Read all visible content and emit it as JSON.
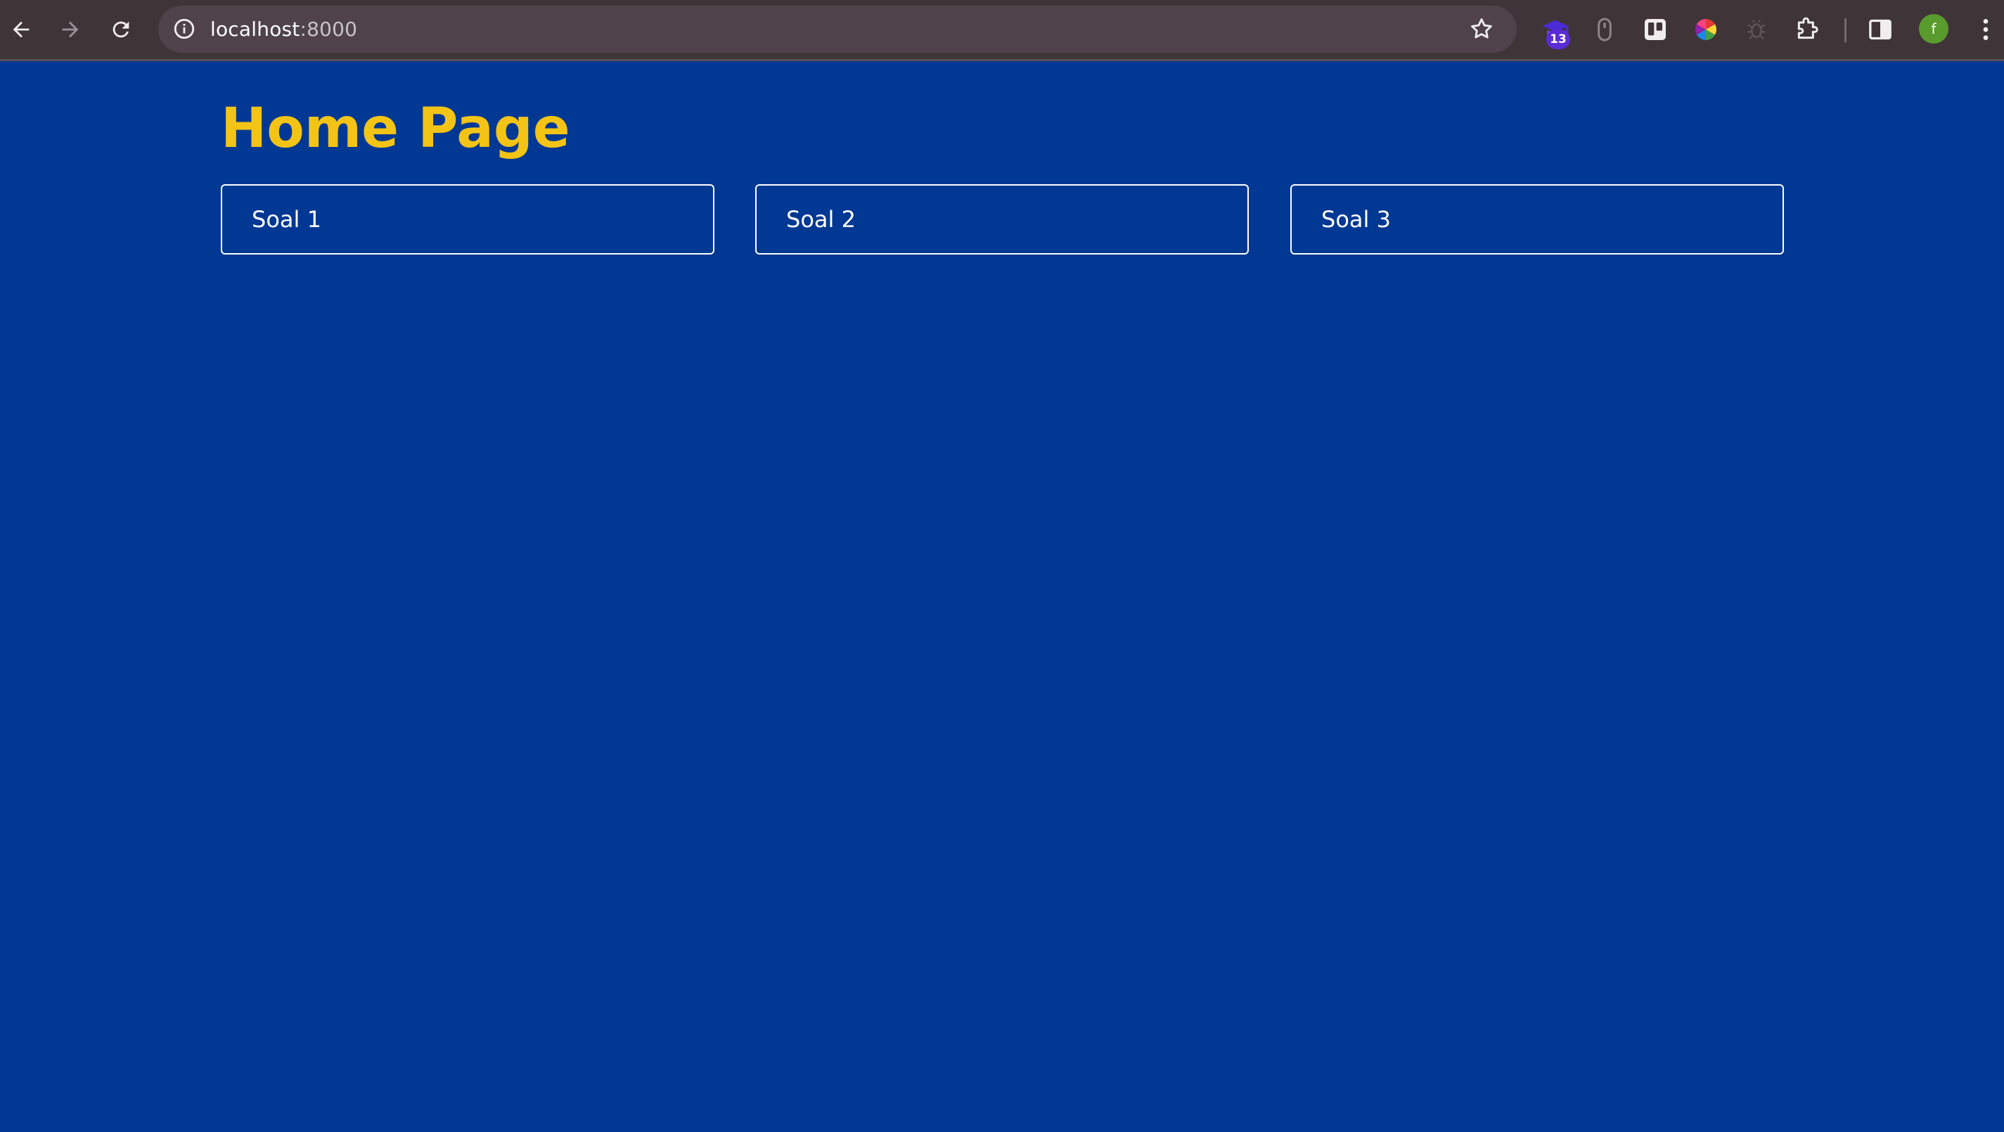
{
  "browser": {
    "address_host": "localhost",
    "address_port": ":8000",
    "extension_badge": "13",
    "profile_initial": "f",
    "icons": [
      "back-arrow-icon",
      "forward-arrow-icon",
      "reload-icon",
      "info-icon",
      "star-icon",
      "graduation-cap-icon",
      "mouse-icon",
      "trello-icon",
      "color-wheel-icon",
      "bug-icon",
      "puzzle-icon",
      "side-panel-icon",
      "kebab-menu-icon"
    ]
  },
  "page": {
    "title": "Home Page",
    "cards": [
      {
        "label": "Soal 1"
      },
      {
        "label": "Soal 2"
      },
      {
        "label": "Soal 3"
      }
    ]
  },
  "colors": {
    "background": "#003893",
    "title": "#f3c316",
    "card_border": "#ffffff",
    "chrome": "#3f3438",
    "omnibox": "#4f4349"
  }
}
